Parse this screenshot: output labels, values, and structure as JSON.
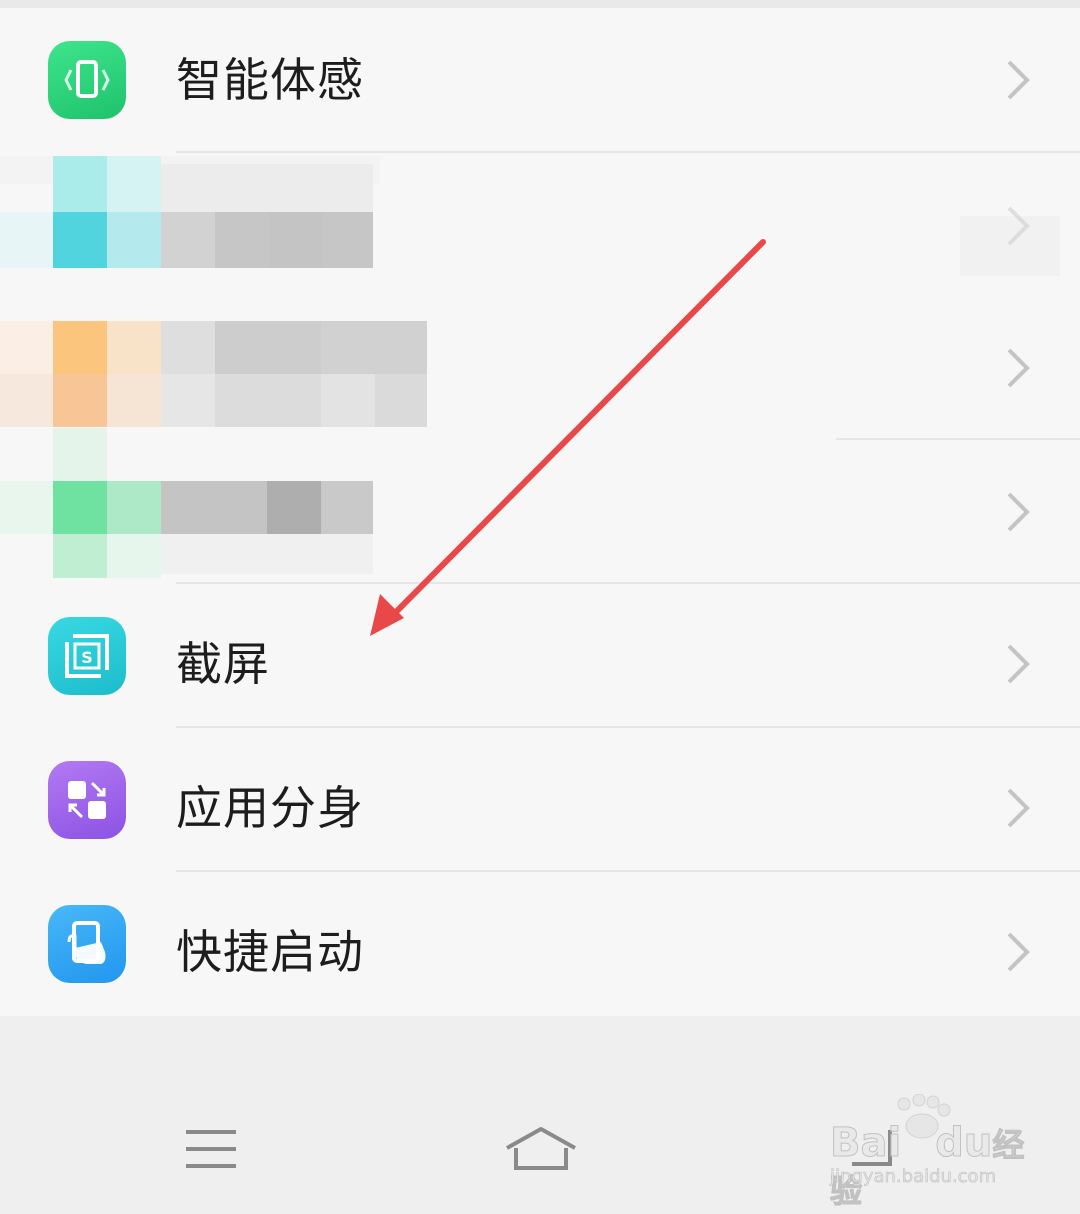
{
  "settings_list": {
    "items": [
      {
        "label": "智能体感",
        "icon": "phone-tilt-icon",
        "color": "#2ed27b"
      },
      {
        "label": "截屏",
        "icon": "screenshot-icon",
        "color": "#27c8d8"
      },
      {
        "label": "应用分身",
        "icon": "app-clone-icon",
        "color": "#a066e8"
      },
      {
        "label": "快捷启动",
        "icon": "quick-launch-icon",
        "color": "#33a7f2"
      }
    ]
  },
  "navbar": {
    "menu_icon": "menu-icon",
    "home_icon": "home-icon",
    "back_icon": "back-icon"
  },
  "watermark": {
    "brand": "Bai",
    "brand2": "du",
    "suffix": "经验",
    "url": "jingyan.baidu.com"
  },
  "annotation": {
    "arrow_color": "#e84848"
  }
}
